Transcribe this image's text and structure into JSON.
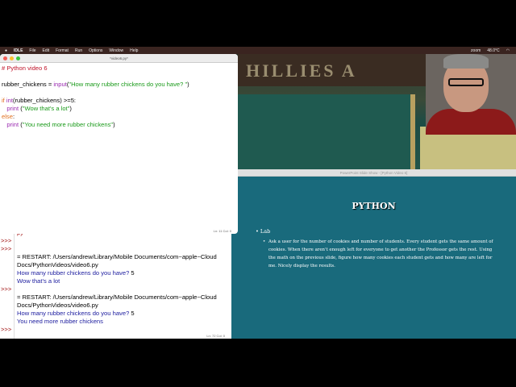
{
  "menubar": {
    "items": [
      "IDLE",
      "File",
      "Edit",
      "Format",
      "Run",
      "Options",
      "Window",
      "Help"
    ],
    "right": [
      "zoom",
      "48.0°C"
    ]
  },
  "editor": {
    "title": "*video6.py*",
    "status": "Ln: 11  Col: 0",
    "comment": "# Python video 6",
    "l2a": "rubber_chickens = ",
    "l2b": "input",
    "l2c": "(",
    "l2d": "\"How many rubber chickens do you have? \"",
    "l2e": ")",
    "l3a": "if ",
    "l3b": "int",
    "l3c": "(rubber_chickens) >=5:",
    "l4a": "   print ",
    "l4b": "(",
    "l4c": "\"Wow that's a lot\"",
    "l4d": ")",
    "l5": "else",
    ":": ":",
    "l6a": "   print ",
    "l6b": "(",
    "l6c": "\"You need more rubber chickens\"",
    "l6d": ")"
  },
  "shell": {
    "status": "Ln: 72  Col: 0",
    "prompt": ">>>",
    "partial": "py",
    "restart1": "= RESTART: /Users/andrew/Library/Mobile Documents/com~apple~Cloud",
    "path1": "Docs/PythonVideos/video6.py",
    "q1": "How many rubber chickens do you have? ",
    "a1": "5",
    "o1": "Wow that's a lot",
    "restart2": "= RESTART: /Users/andrew/Library/Mobile Documents/com~apple~Cloud",
    "path2": "Docs/PythonVideos/video6.py",
    "q2": "How many rubber chickens do you have? ",
    "a2": "5",
    "o2": "You need more rubber chickens"
  },
  "slide": {
    "window_title": "PowerPoint Slide Show - [Python Video 6]",
    "title": "PYTHON",
    "bullet": "Lab",
    "sub": "Ask a user for the number of cookies and number of students. Every student gets the same amount of cookies. When there aren't enough left for everyone to get another the Professor gets the rest. Using the math on the previous slide, figure how many cookies each student gets and how many are left for me. Nicely display the results."
  },
  "webcam": {
    "sign": "HILLIES A"
  }
}
